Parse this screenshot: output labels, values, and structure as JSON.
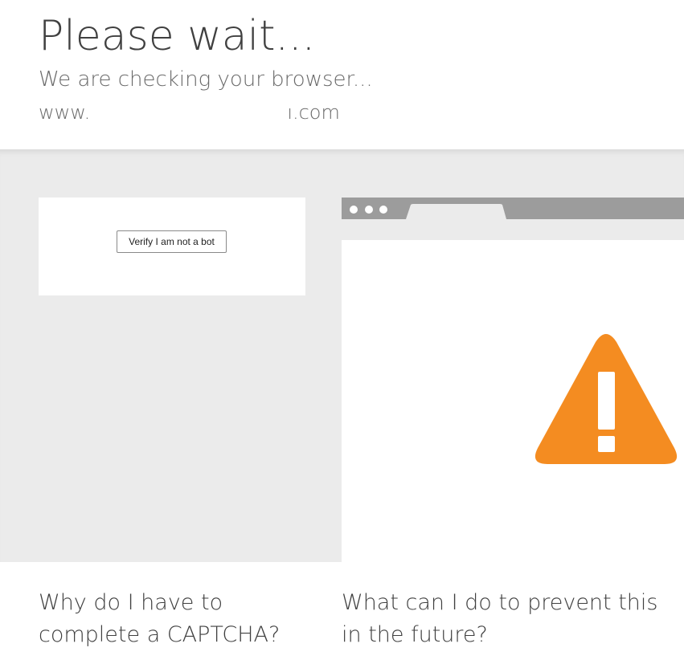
{
  "header": {
    "title": "Please wait...",
    "subtitle": "We are checking your browser...",
    "domain_prefix": "www.",
    "domain_suffix": "ı.com"
  },
  "captcha": {
    "verify_button_label": "Verify I am not a bot"
  },
  "illustration": {
    "icon": "warning-icon",
    "warning_color": "#f48c21",
    "browser_bar_color": "#9c9c9c"
  },
  "questions": {
    "why_captcha": "Why do I have to complete a CAPTCHA?",
    "prevent_future": "What can I do to prevent this in the future?"
  },
  "colors": {
    "band_background": "#ebebeb",
    "text": "#404040"
  }
}
